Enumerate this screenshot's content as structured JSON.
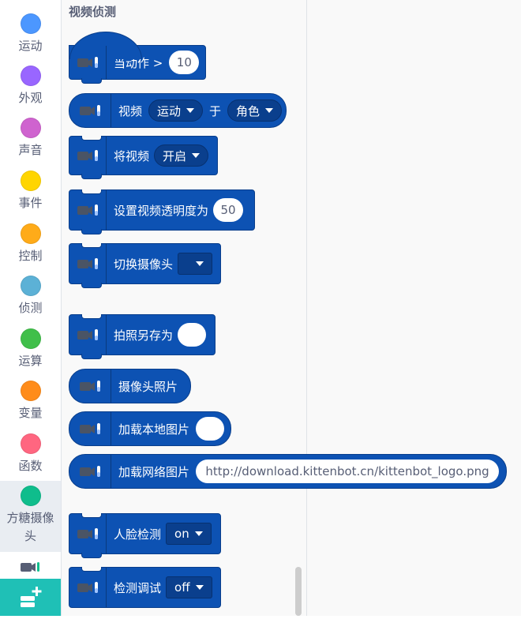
{
  "categories": [
    {
      "label": "运动",
      "color": "#4c97ff"
    },
    {
      "label": "外观",
      "color": "#9966ff"
    },
    {
      "label": "声音",
      "color": "#cf63cf"
    },
    {
      "label": "事件",
      "color": "#ffd500"
    },
    {
      "label": "控制",
      "color": "#ffab19"
    },
    {
      "label": "侦测",
      "color": "#5cb1d6"
    },
    {
      "label": "运算",
      "color": "#40bf4a"
    },
    {
      "label": "变量",
      "color": "#ff8c1a"
    },
    {
      "label": "函数",
      "color": "#ff6680"
    },
    {
      "label": "方糖摄像头",
      "color": "#0fbd8c"
    }
  ],
  "palette": {
    "title": "视频侦测",
    "blocks": {
      "motion_hat": {
        "label": "当动作 >",
        "value": "10"
      },
      "video_sensing": {
        "label": "视频",
        "attr": "运动",
        "of_label": "于",
        "target": "角色"
      },
      "turn_video": {
        "label": "将视频",
        "state": "开启"
      },
      "transparency": {
        "label": "设置视频透明度为",
        "value": "50"
      },
      "switch_camera": {
        "label": "切换摄像头",
        "value": ""
      },
      "snapshot_save": {
        "label": "拍照另存为",
        "value": ""
      },
      "camera_photo": {
        "label": "摄像头照片"
      },
      "load_local": {
        "label": "加载本地图片",
        "value": ""
      },
      "load_web": {
        "label": "加载网络图片",
        "value": "http://download.kittenbot.cn/kittenbot_logo.png"
      },
      "face_detect": {
        "label": "人脸检测",
        "state": "on"
      },
      "detect_debug": {
        "label": "检测调试",
        "state": "off"
      }
    }
  },
  "colors": {
    "block": "#0d52b3",
    "extension_button": "#1fc0b6"
  }
}
